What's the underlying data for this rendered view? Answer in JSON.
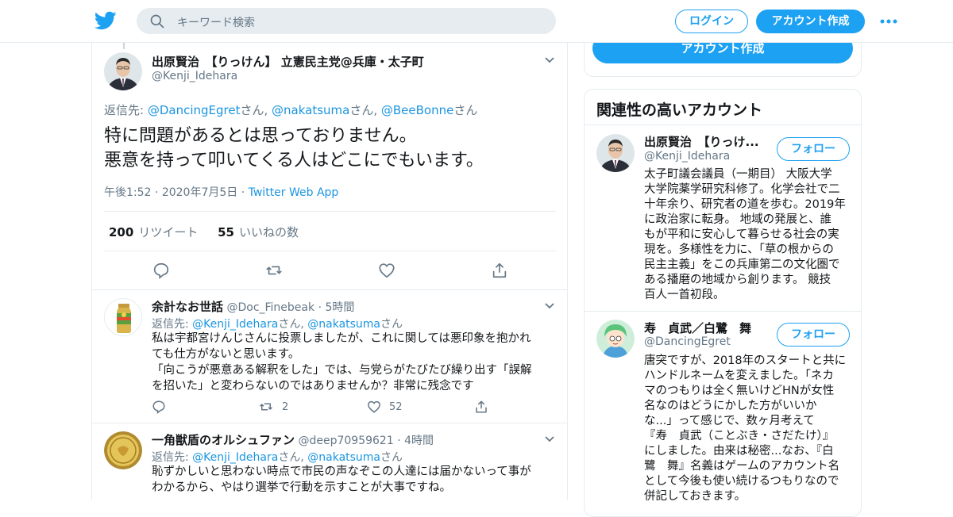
{
  "header": {
    "search_placeholder": "キーワード検索",
    "login_label": "ログイン",
    "signup_label": "アカウント作成"
  },
  "focus_tweet": {
    "display_name": "出原賢治　【りっけん】 立憲民主党@兵庫・太子町",
    "handle": "@Kenji_Idehara",
    "reply_prefix": "返信先: ",
    "reply_to": [
      {
        "handle": "@DancingEgret",
        "suffix": "さん, "
      },
      {
        "handle": "@nakatsuma",
        "suffix": "さん, "
      },
      {
        "handle": "@BeeBonne",
        "suffix": "さん"
      }
    ],
    "text_line1": "特に問題があるとは思っておりません。",
    "text_line2": "悪意を持って叩いてくる人はどこにでもいます。",
    "time": "午後1:52",
    "date": "2020年7月5日",
    "source": "Twitter Web App",
    "retweet_count": "200",
    "retweet_label": "リツイート",
    "like_count": "55",
    "like_label": "いいねの数"
  },
  "replies": [
    {
      "display_name": "余計なお世話",
      "handle": "@Doc_Finebeak",
      "age": "5時間",
      "reply_prefix": "返信先: ",
      "reply_to_1": "@Kenji_Idehara",
      "reply_sep_1": "さん, ",
      "reply_to_2": "@nakatsuma",
      "reply_sep_2": "さん",
      "lines": [
        "私は宇都宮けんじさんに投票しましたが、これに関しては悪印象を抱かれ",
        "ても仕方がないと思います。",
        "「向こうが悪意ある解釈をした」では、与党らがたびたび繰り出す「誤解",
        "を招いた」と変わらないのではありませんか？非常に残念です"
      ],
      "retweets": "2",
      "likes": "52"
    },
    {
      "display_name": "一角獣盾のオルシュファン",
      "handle": "@deep70959621",
      "age": "4時間",
      "reply_prefix": "返信先: ",
      "reply_to_1": "@Kenji_Idehara",
      "reply_sep_1": "さん, ",
      "reply_to_2": "@nakatsuma",
      "reply_sep_2": "さん",
      "lines": [
        "恥ずかしいと思わない時点で市民の声なぞこの人達には届かないって事が",
        "わかるから、やはり選挙で行動を示すことが大事ですね。"
      ]
    }
  ],
  "sidebar": {
    "signup_label": "アカウント作成",
    "related_title": "関連性の高いアカウント",
    "follow_label": "フォロー",
    "accounts": [
      {
        "display_name": "出原賢治　【りっけ...",
        "handle": "@Kenji_Idehara",
        "bio_lines": [
          "太子町議会議員（一期目） 大阪大学",
          "大学院薬学研究科修了。化学会社で二",
          "十年余り、研究者の道を歩む。2019年",
          "に政治家に転身。 地域の発展と、誰",
          "もが平和に安心して暮らせる社会の実",
          "現を。多様性を力に、「草の根からの",
          "民主主義」をこの兵庫第二の文化圏で",
          "ある播磨の地域から創ります。 競技",
          "百人一首初段。"
        ]
      },
      {
        "display_name": "寿　貞武／白鷺　舞",
        "handle": "@DancingEgret",
        "bio_lines": [
          "唐突ですが、2018年のスタートと共に",
          "ハンドルネームを変えました。「ネカ",
          "マのつもりは全く無いけどHNが女性",
          "名なのはどうにかした方がいいか",
          "な...」って感じで、数ヶ月考えて",
          "『寿　貞武（ことぶき・さだたけ）』",
          "にしました。由来は秘密...なお、『白",
          "鷺　舞』名義はゲームのアカウント名",
          "として今後も使い続けるつもりなので",
          "併記しておきます。"
        ]
      }
    ]
  },
  "colors": {
    "accent": "#1da1f2",
    "link": "#1b95e0",
    "muted": "#657786",
    "border": "#e6ecf0"
  }
}
